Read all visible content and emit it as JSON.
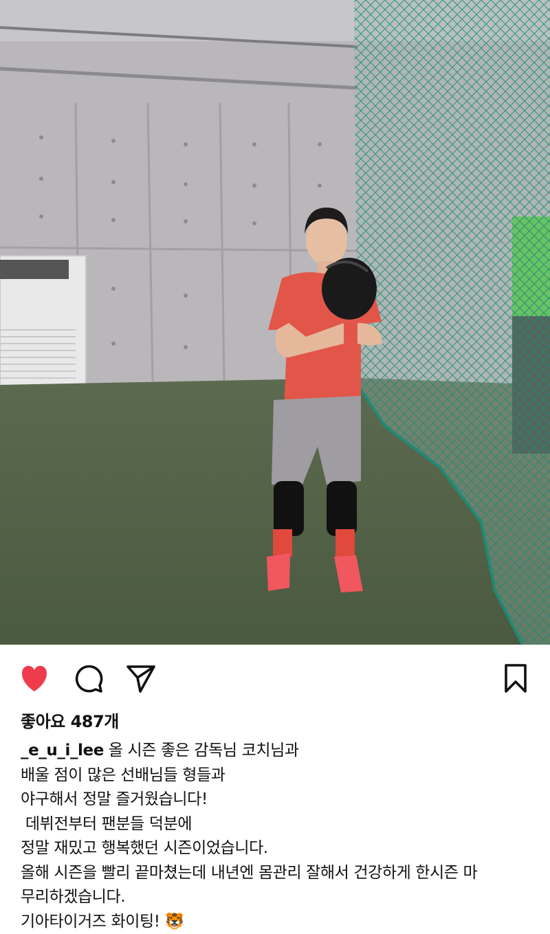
{
  "post": {
    "image_description_icon": "photo",
    "actions": {
      "like_icon": "heart-filled-icon",
      "comment_icon": "comment-icon",
      "share_icon": "send-icon",
      "save_icon": "bookmark-icon",
      "liked": true,
      "like_color": "#ee3c4d"
    },
    "likes_label": "좋아요 487개",
    "caption": {
      "username": "_e_u_i_lee",
      "first_line_rest": " 올 시즌 좋은 감독님 코치님과",
      "lines": [
        "배울 점이 많은 선배님들 형들과",
        "야구해서 정말 즐거웠습니다!",
        " 데뷔전부터 팬분들 덕분에",
        "정말 재밌고 행복했던 시즌이었습니다.",
        "올해 시즌을 빨리 끝마쳤는데 내년엔 몸관리 잘해서 건강하게 한시즌 마",
        "무리하겠습니다."
      ],
      "last_line": "기아타이거즈 화이팅! ",
      "emoji": "🐯"
    }
  }
}
